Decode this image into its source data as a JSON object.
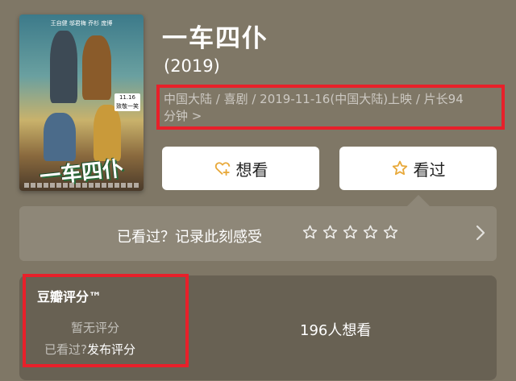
{
  "poster": {
    "actors": "王自健 邬君梅 乔杉 庞博",
    "date_badge_line1": "11.16",
    "date_badge_line2": "致敬一笑",
    "logo_text": "一车四仆"
  },
  "movie": {
    "title": "一车四仆",
    "year": "(2019)",
    "meta_line1": "中国大陆 / 喜剧 / 2019-11-16(中国大陆)上映 / 片长94",
    "meta_line2": "分钟 >"
  },
  "actions": {
    "want_label": "想看",
    "seen_label": "看过",
    "want_icon": "heart-plus-icon",
    "seen_icon": "star-icon"
  },
  "record": {
    "prompt": "已看过？记录此刻感受",
    "star_count": 5,
    "chevron_icon": "chevron-right-icon"
  },
  "rating": {
    "title": "豆瓣评分™",
    "no_rating": "暂无评分",
    "seen_question": "已看过?",
    "publish_link": "发布评分",
    "want_count_text": "196人想看"
  },
  "colors": {
    "background": "#7f7766",
    "highlight_border": "#e8202a",
    "button_bg": "#ffffff",
    "icon_accent": "#e8a93b"
  }
}
